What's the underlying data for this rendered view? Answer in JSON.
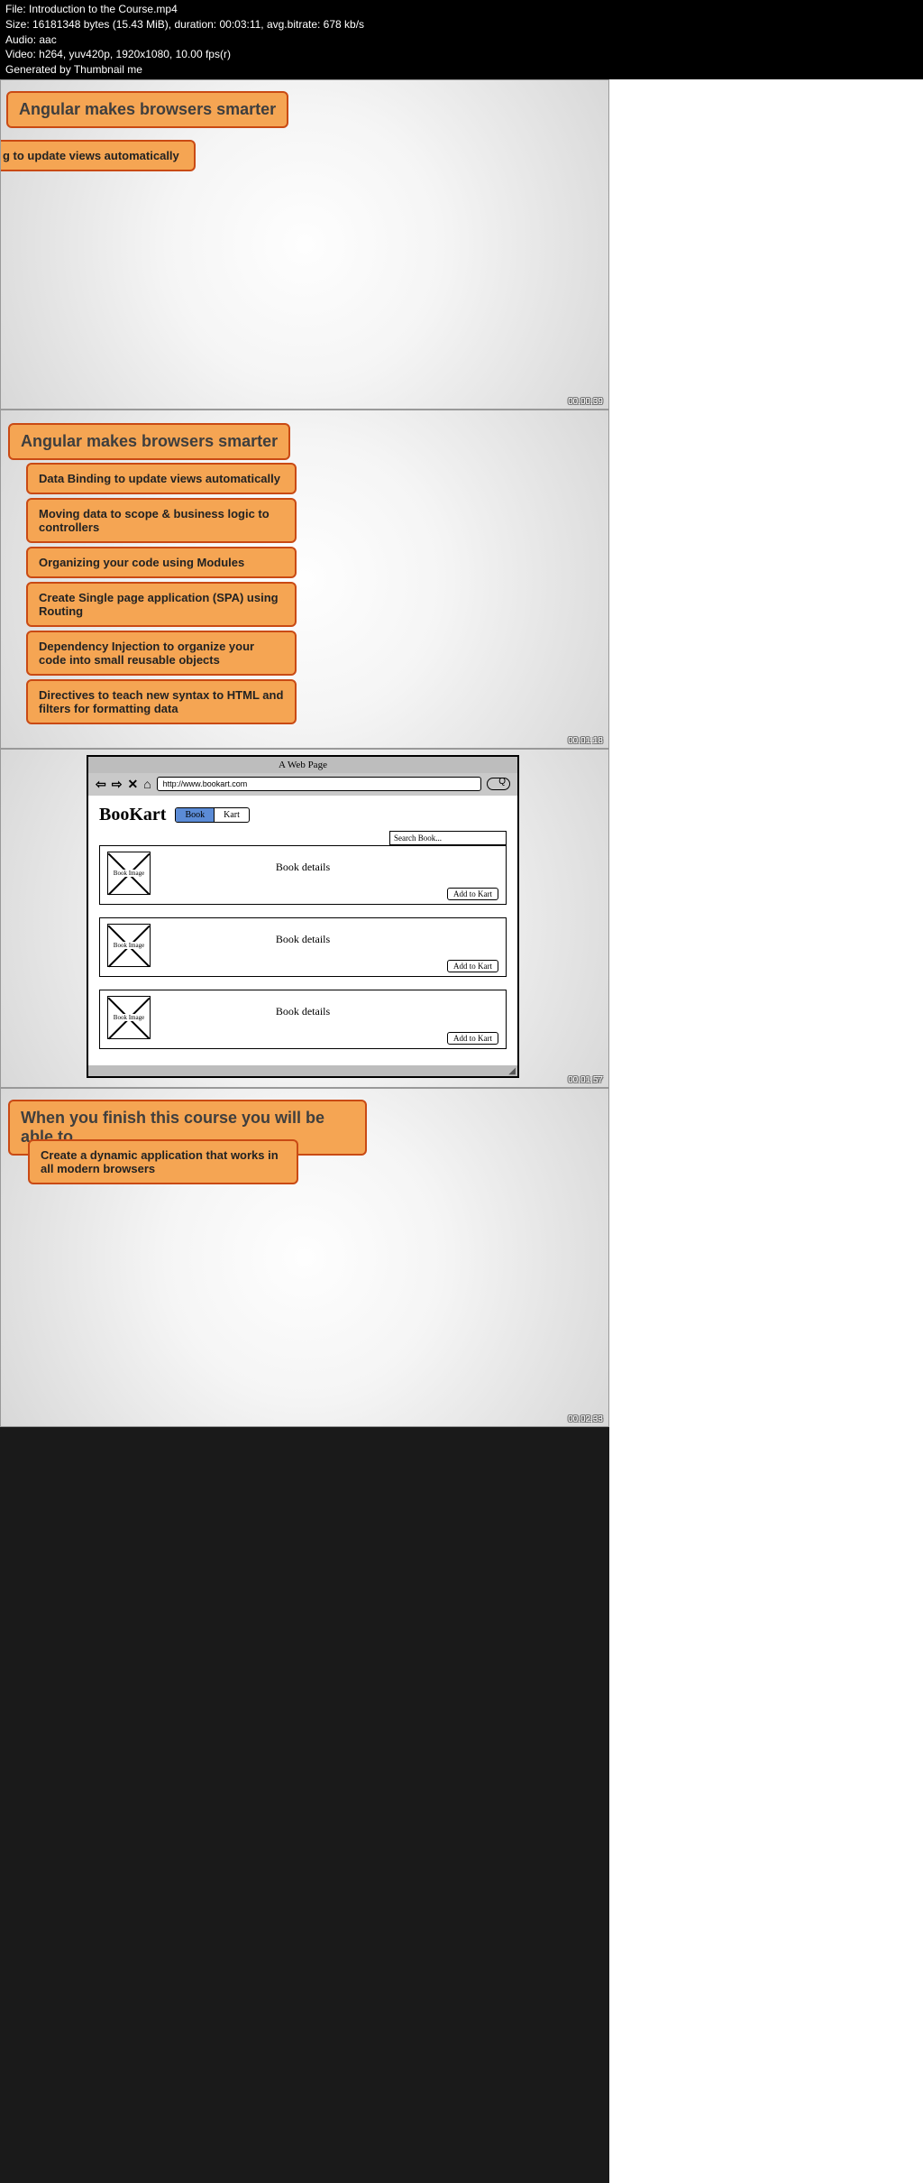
{
  "header": {
    "file_line": "File: Introduction to the Course.mp4",
    "size_line": "Size: 16181348 bytes (15.43 MiB), duration: 00:03:11, avg.bitrate: 678 kb/s",
    "audio_line": "Audio: aac",
    "video_line": "Video: h264, yuv420p, 1920x1080, 10.00 fps(r)",
    "generated_line": "Generated by Thumbnail me"
  },
  "thumb1": {
    "title": "Angular makes browsers smarter",
    "bullet": "g to update views automatically",
    "timestamp": "00:00:39"
  },
  "thumb2": {
    "title": "Angular makes browsers smarter",
    "bullets": [
      "Data Binding to update views automatically",
      "Moving data to scope & business logic to controllers",
      "Organizing your code using Modules",
      "Create Single page application (SPA) using Routing",
      "Dependency Injection to organize your code into small reusable objects",
      "Directives to teach new syntax to HTML and filters for formatting data"
    ],
    "timestamp": "00:01:18"
  },
  "thumb3": {
    "wf_pagetitle": "A Web Page",
    "wf_url": "http://www.bookart.com",
    "wf_logo": "BooKart",
    "wf_tab_book": "Book",
    "wf_tab_kart": "Kart",
    "wf_search_placeholder": "Search Book...",
    "wf_img_label": "Book Image",
    "wf_details": "Book details",
    "wf_add": "Add to Kart",
    "timestamp": "00:01:57"
  },
  "thumb4": {
    "title": "When you finish this course you will be able to",
    "bullet": "Create a dynamic application that works in all modern browsers",
    "timestamp": "00:02:33"
  }
}
